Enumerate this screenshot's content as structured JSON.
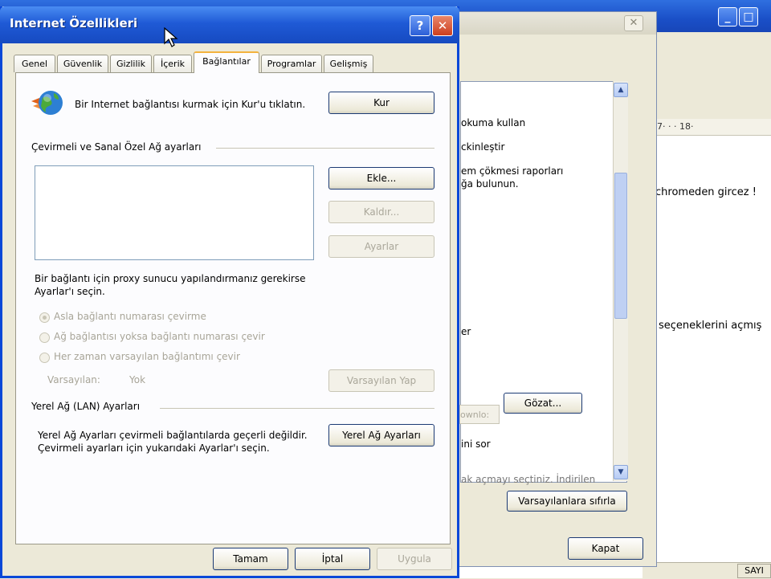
{
  "main_dialog": {
    "title": "Internet Özellikleri",
    "help_label": "?",
    "close_label": "✕",
    "tabs": [
      {
        "label": "Genel"
      },
      {
        "label": "Güvenlik"
      },
      {
        "label": "Gizlilik"
      },
      {
        "label": "İçerik"
      },
      {
        "label": "Bağlantılar"
      },
      {
        "label": "Programlar"
      },
      {
        "label": "Gelişmiş"
      }
    ],
    "active_tab": "Bağlantılar",
    "setup": {
      "text": "Bir Internet bağlantısı kurmak için Kur'u tıklatın.",
      "button": "Kur"
    },
    "dialup": {
      "heading": "Çevirmeli ve Sanal Özel Ağ ayarları",
      "add_button": "Ekle...",
      "remove_button": "Kaldır...",
      "settings_button": "Ayarlar",
      "proxy_text_line1": "Bir bağlantı için proxy sunucu yapılandırmanız gerekirse",
      "proxy_text_line2": "Ayarlar'ı seçin.",
      "radio_never": "Asla bağlantı numarası çevirme",
      "radio_when_absent": "Ağ bağlantısı yoksa bağlantı numarası çevir",
      "radio_always": "Her zaman varsayılan bağlantımı çevir",
      "default_label": "Varsayılan:",
      "default_value": "Yok",
      "set_default_button": "Varsayılan Yap"
    },
    "lan": {
      "heading": "Yerel Ağ (LAN) Ayarları",
      "text_line1": "Yerel Ağ Ayarları çevirmeli bağlantılarda geçerli değildir.",
      "text_line2": "Çevirmeli ayarları için yukarıdaki Ayarlar'ı seçin.",
      "button": "Yerel Ağ Ayarları"
    },
    "footer": {
      "ok": "Tamam",
      "cancel": "İptal",
      "apply": "Uygula"
    }
  },
  "second_dialog": {
    "close_label": "✕",
    "lines": [
      "okuma kullan",
      "ckinleştir",
      "em çökmesi raporları",
      "ğa bulunun.",
      "er",
      "ini sor",
      "ak açmayı seçtiniz. İndirilen"
    ],
    "downloads_field": "ownlo:",
    "browse_button": "Gözat...",
    "reset_button": "Varsayılanlara sıfırla",
    "close_button": "Kapat"
  },
  "background_window": {
    "ruler_text": "7· · · 18·",
    "text1": "chromeden gircez !",
    "text2": "seçeneklerini açmış",
    "status_sayi": "SAYI",
    "min_label": "_",
    "max_label": "□"
  },
  "colors": {
    "xp_blue": "#1f5ad6",
    "xp_close_red": "#cc3f1f",
    "dialog_face": "#ece9d8",
    "active_tab_accent": "#f3b33e"
  }
}
